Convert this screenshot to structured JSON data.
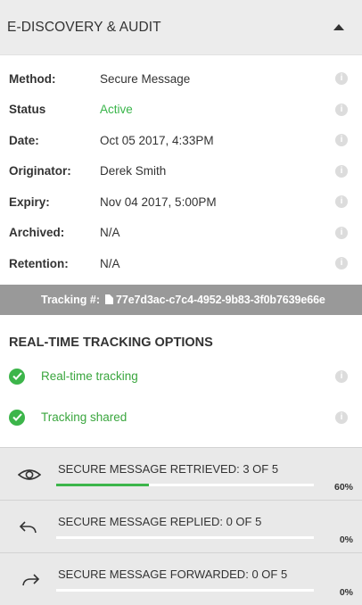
{
  "header": {
    "title": "E-DISCOVERY & AUDIT"
  },
  "details": [
    {
      "label": "Method:",
      "value": "Secure Message"
    },
    {
      "label": "Status",
      "value": "Active"
    },
    {
      "label": "Date:",
      "value": "Oct 05 2017, 4:33PM"
    },
    {
      "label": "Originator:",
      "value": "Derek Smith"
    },
    {
      "label": "Expiry:",
      "value": "Nov 04 2017, 5:00PM"
    },
    {
      "label": "Archived:",
      "value": "N/A"
    },
    {
      "label": "Retention:",
      "value": "N/A"
    }
  ],
  "tracking": {
    "label": "Tracking #:",
    "id": "77e7d3ac-c7c4-4952-9b83-3f0b7639e66e"
  },
  "realtime": {
    "title": "REAL-TIME TRACKING OPTIONS",
    "options": [
      {
        "label": "Real-time tracking"
      },
      {
        "label": "Tracking shared"
      }
    ]
  },
  "stats": [
    {
      "label": "SECURE MESSAGE RETRIEVED:",
      "count": "3 OF 5",
      "percent": "60%",
      "fill": 0.6,
      "icon": "eye-icon"
    },
    {
      "label": "SECURE MESSAGE REPLIED:",
      "count": "0 OF 5",
      "percent": "0%",
      "fill": 0,
      "icon": "reply-arrow-icon"
    },
    {
      "label": "SECURE MESSAGE FORWARDED:",
      "count": "0 OF 5",
      "percent": "0%",
      "fill": 0,
      "icon": "forward-arrow-icon"
    }
  ],
  "colors": {
    "success": "#3cb54a",
    "status_active": "#39b54a",
    "tracking_bar": "#999999",
    "header_bg": "#ececec",
    "stat_bg": "#e9e9e9"
  }
}
